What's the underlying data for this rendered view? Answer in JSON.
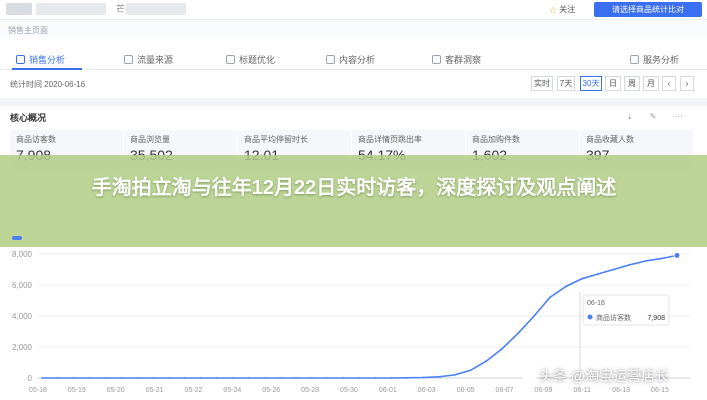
{
  "top_bar": {
    "shop_name_visible": "芒果",
    "follow_label": "关注",
    "apply_label": "请选择商品统计比对"
  },
  "tab_bar": {
    "current": "销售主页面"
  },
  "nav": {
    "items": [
      "销售分析",
      "流量来源",
      "标题优化",
      "内容分析",
      "客群洞察",
      "服务分析"
    ]
  },
  "date_range": {
    "label": "统计时间 2020-06-16",
    "buttons": [
      "实时",
      "7天",
      "30天",
      "日",
      "周",
      "月"
    ],
    "active": "30天"
  },
  "section": {
    "title": "核心概况",
    "tools": "⤓ ✎ ⋯"
  },
  "metrics": [
    {
      "label": "商品访客数",
      "value": "7,908"
    },
    {
      "label": "商品浏览量",
      "value": "35,502"
    },
    {
      "label": "商品平均停留时长",
      "value": "12.01"
    },
    {
      "label": "商品详情页跳出率",
      "value": "54.17%"
    },
    {
      "label": "商品加购件数",
      "value": "1,602"
    },
    {
      "label": "商品收藏人数",
      "value": "397"
    }
  ],
  "banner": {
    "title": "手淘拍立淘与往年12月22日实时访客，深度探讨及观点阐述"
  },
  "tooltip": {
    "date": "06-16",
    "series_label": "商品访客数",
    "value": "7,908"
  },
  "watermark": {
    "text": "头条 @淘宝运营店长"
  },
  "colors": {
    "accent": "#3b6ff2",
    "line": "#4a7ff5",
    "banner": "#b0cd84"
  },
  "chart_data": {
    "type": "line",
    "series": [
      {
        "name": "商品访客数",
        "values": [
          0,
          0,
          0,
          0,
          0,
          0,
          0,
          0,
          0,
          0,
          0,
          0,
          0,
          0,
          0,
          0,
          0,
          0,
          0,
          0,
          0,
          0,
          0,
          10,
          30,
          80,
          200,
          500,
          1100,
          1900,
          2900,
          4000,
          5200,
          5900,
          6400,
          6700,
          7000,
          7300,
          7550,
          7700,
          7908
        ]
      }
    ],
    "x_tick_labels": [
      "05-18",
      "05-19",
      "05-20",
      "05-21",
      "05-22",
      "05-24",
      "05-26",
      "05-28",
      "05-30",
      "06-01",
      "06-03",
      "06-05",
      "06-07",
      "06-09",
      "06-11",
      "06-13",
      "06-15"
    ],
    "y_tick_labels": [
      "0",
      "2,000",
      "4,000",
      "6,000",
      "8,000"
    ],
    "ylim": [
      0,
      8000
    ],
    "grid": true
  }
}
